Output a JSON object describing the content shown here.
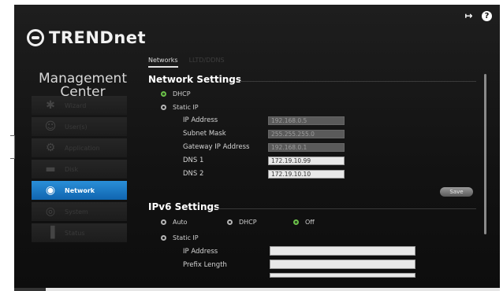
{
  "header": {
    "brand": "TRENDnet",
    "logout_icon": "logout-icon",
    "help_icon": "help-icon"
  },
  "sidebar": {
    "title": "Management Center",
    "items": [
      {
        "label": "Wizard",
        "icon": "wizard-icon"
      },
      {
        "label": "User(s)",
        "icon": "users-icon"
      },
      {
        "label": "Application",
        "icon": "application-icon"
      },
      {
        "label": "Disk",
        "icon": "disk-icon"
      },
      {
        "label": "Network",
        "icon": "network-icon",
        "active": true
      },
      {
        "label": "System",
        "icon": "system-icon"
      },
      {
        "label": "Status",
        "icon": "status-icon"
      }
    ]
  },
  "tabs": [
    {
      "label": "Networks",
      "active": true
    },
    {
      "label": "LLTD/DDNS",
      "active": false
    }
  ],
  "network_settings": {
    "title": "Network Settings",
    "dhcp_label": "DHCP",
    "static_ip_label": "Static IP",
    "selected": "DHCP",
    "fields": [
      {
        "label": "IP Address",
        "value": "192.168.0.5"
      },
      {
        "label": "Subnet Mask",
        "value": "255.255.255.0"
      },
      {
        "label": "Gateway IP Address",
        "value": "192.168.0.1"
      },
      {
        "label": "DNS 1",
        "value": "172.19.10.99"
      },
      {
        "label": "DNS 2",
        "value": "172.19.10.10"
      }
    ]
  },
  "save_label": "Save",
  "ipv6_settings": {
    "title": "IPv6 Settings",
    "auto_label": "Auto",
    "dhcp_label": "DHCP",
    "off_label": "Off",
    "static_ip_label": "Static IP",
    "selected": "Off",
    "fields": [
      {
        "label": "IP Address",
        "value": ""
      },
      {
        "label": "Prefix Length",
        "value": ""
      }
    ]
  },
  "colors": {
    "accent_active": "#1e7cc8",
    "radio_checked": "#6cc24a"
  }
}
